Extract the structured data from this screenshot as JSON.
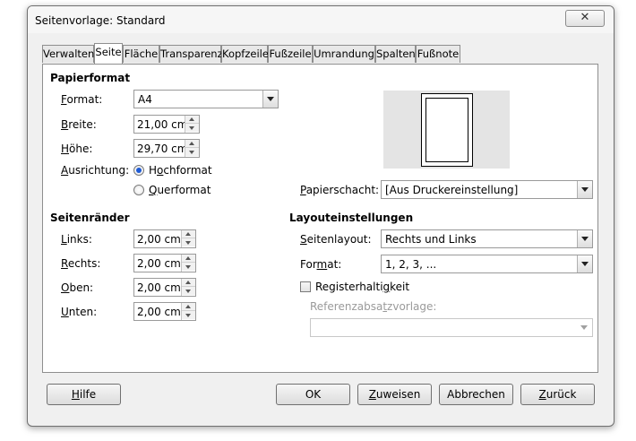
{
  "window": {
    "title": "Seitenvorlage: Standard",
    "close_glyph": "✕"
  },
  "tabs": [
    {
      "label": "Verwalten"
    },
    {
      "label": "Seite"
    },
    {
      "label": "Fläche"
    },
    {
      "label": "Transparenz"
    },
    {
      "label": "Kopfzeile"
    },
    {
      "label": "Fußzeile"
    },
    {
      "label": "Umrandung"
    },
    {
      "label": "Spalten"
    },
    {
      "label": "Fußnote"
    }
  ],
  "active_tab": "Seite",
  "paper": {
    "heading": "Papierformat",
    "format_label_u": "F",
    "format_label_rest": "ormat:",
    "format_value": "A4",
    "width_label_u": "B",
    "width_label_rest": "reite:",
    "width_value": "21,00 cm",
    "height_label_u": "H",
    "height_label_rest": "öhe:",
    "height_value": "29,70 cm",
    "orientation_label_u": "A",
    "orientation_label_rest": "usrichtung:",
    "portrait_pre": "H",
    "portrait_u": "o",
    "portrait_rest": "chformat",
    "landscape_u": "Q",
    "landscape_rest": "uerformat",
    "orientation_selected": "Hochformat",
    "tray_label_u": "P",
    "tray_label_rest": "apierschacht:",
    "tray_value": "[Aus Druckereinstellung]"
  },
  "margins": {
    "heading": "Seitenränder",
    "left_label_u": "L",
    "left_label_rest": "inks:",
    "left_value": "2,00 cm",
    "right_label_u": "R",
    "right_label_rest": "echts:",
    "right_value": "2,00 cm",
    "top_label_u": "O",
    "top_label_rest": "ben:",
    "top_value": "2,00 cm",
    "bottom_label_u": "U",
    "bottom_label_rest": "nten:",
    "bottom_value": "2,00 cm"
  },
  "layout": {
    "heading": "Layouteinstellungen",
    "page_layout_label_u": "S",
    "page_layout_label_rest": "eitenlayout:",
    "page_layout_value": "Rechts und Links",
    "format_label_pre": "For",
    "format_label_u": "m",
    "format_label_rest": "at:",
    "format_value": "1, 2, 3, ...",
    "register_pre": "Registerhalti",
    "register_u": "g",
    "register_rest": "keit",
    "register_checked": false,
    "ref_style_pre": "Referenzabsa",
    "ref_style_u": "t",
    "ref_style_rest": "zvorlage:",
    "ref_style_value": ""
  },
  "buttons": {
    "help_u": "H",
    "help_rest": "ilfe",
    "ok": "OK",
    "reset_u": "Z",
    "reset_rest": "uweisen",
    "cancel": "Abbrechen",
    "back_u": "Z",
    "back_rest": "urück"
  },
  "colors": {
    "panel_bg": "#ffffff",
    "window_bg": "#f0f0f0",
    "radio_selected": "#1e5bd6"
  }
}
